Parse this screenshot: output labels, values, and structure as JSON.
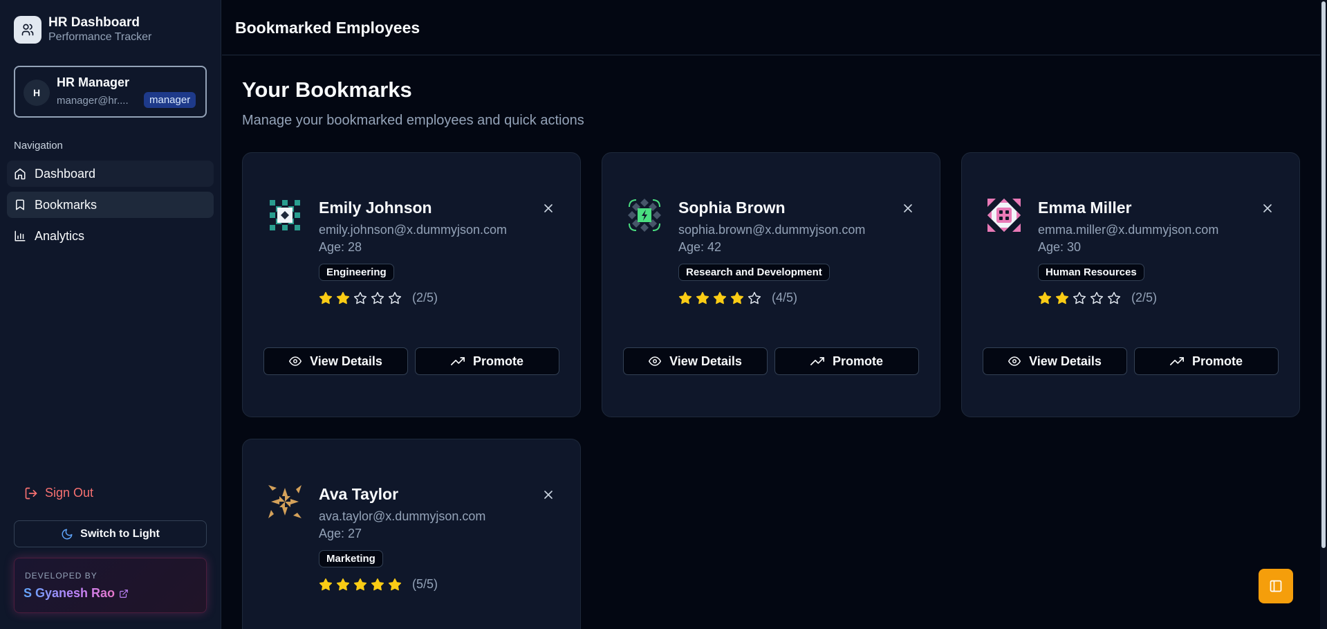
{
  "sidebar": {
    "brand_title": "HR Dashboard",
    "brand_subtitle": "Performance Tracker",
    "user": {
      "initial": "H",
      "name": "HR Manager",
      "email": "manager@hr....",
      "role": "manager"
    },
    "nav_heading": "Navigation",
    "nav_items": [
      {
        "label": "Dashboard",
        "icon": "home-icon"
      },
      {
        "label": "Bookmarks",
        "icon": "bookmark-icon"
      },
      {
        "label": "Analytics",
        "icon": "bar-chart-icon"
      }
    ],
    "sign_out": "Sign Out",
    "theme_toggle": "Switch to Light",
    "dev_label": "DEVELOPED BY",
    "dev_name": "S Gyanesh Rao"
  },
  "header": {
    "title": "Bookmarked Employees"
  },
  "main": {
    "title": "Your Bookmarks",
    "subtitle": "Manage your bookmarked employees and quick actions",
    "view_label": "View Details",
    "promote_label": "Promote",
    "employees": [
      {
        "name": "Emily Johnson",
        "email": "emily.johnson@x.dummyjson.com",
        "age": "Age: 28",
        "department": "Engineering",
        "rating": 2,
        "rating_text": "(2/5)",
        "avatar_color": "#2a9d8f"
      },
      {
        "name": "Sophia Brown",
        "email": "sophia.brown@x.dummyjson.com",
        "age": "Age: 42",
        "department": "Research and Development",
        "rating": 4,
        "rating_text": "(4/5)",
        "avatar_color": "#4ade80"
      },
      {
        "name": "Emma Miller",
        "email": "emma.miller@x.dummyjson.com",
        "age": "Age: 30",
        "department": "Human Resources",
        "rating": 2,
        "rating_text": "(2/5)",
        "avatar_color": "#e879b6"
      },
      {
        "name": "Ava Taylor",
        "email": "ava.taylor@x.dummyjson.com",
        "age": "Age: 27",
        "department": "Marketing",
        "rating": 5,
        "rating_text": "(5/5)",
        "avatar_color": "#d4a15a"
      }
    ]
  },
  "colors": {
    "accent": "#f59e0b",
    "star": "#facc15",
    "danger": "#f87171",
    "role_badge": "#1e3a8a"
  }
}
